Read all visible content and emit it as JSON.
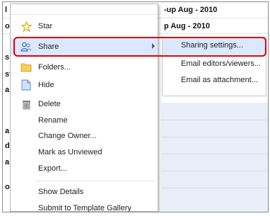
{
  "background": {
    "right_texts": [
      "-up Aug - 2010",
      "p Aug - 2010"
    ],
    "left_fragments": [
      "l",
      "o",
      "s",
      "st",
      "a",
      "a",
      "d:",
      "a",
      "o"
    ]
  },
  "menu": {
    "items": [
      {
        "label": "Star",
        "icon": "star-icon"
      },
      {
        "label": "Share",
        "icon": "share-people-icon",
        "has_submenu": true
      },
      {
        "label": "Folders...",
        "icon": "folder-icon"
      },
      {
        "label": "Hide",
        "icon": "hide-document-icon"
      },
      {
        "label": "Delete",
        "icon": "trash-icon"
      },
      {
        "label": "Rename"
      },
      {
        "label": "Change Owner..."
      },
      {
        "label": "Mark as Unviewed"
      },
      {
        "label": "Export..."
      },
      {
        "label": "Show Details"
      },
      {
        "label": "Submit to Template Gallery"
      }
    ]
  },
  "submenu": {
    "items": [
      {
        "label": "Sharing settings..."
      },
      {
        "label": "Email editors/viewers..."
      },
      {
        "label": "Email as attachment..."
      }
    ]
  },
  "colors": {
    "highlight": "#dbe8ff",
    "annotation": "#e00000",
    "star": "#e8c200",
    "folder": "#f4c542"
  }
}
